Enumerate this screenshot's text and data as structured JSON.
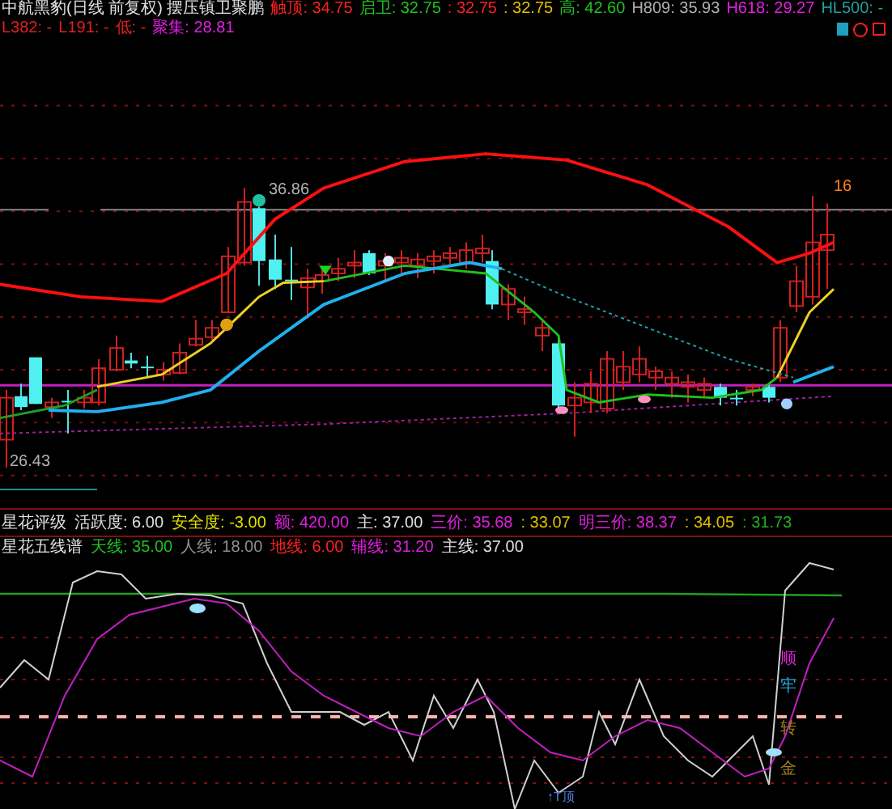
{
  "title": "中航黑豹(日线 前复权) 摆压镇卫聚鹏",
  "indicators": [
    {
      "text": "触顶: 34.75",
      "color": "#ff2020"
    },
    {
      "text": "启卫: 32.75",
      "color": "#20c020"
    },
    {
      "text": ": 32.75",
      "color": "#ff2020"
    },
    {
      "text": ": 32.75",
      "color": "#e0c000"
    },
    {
      "text": "高: 42.60",
      "color": "#20c020"
    },
    {
      "text": "H809: 35.93",
      "color": "#b0b0b0"
    },
    {
      "text": "H618: 29.27",
      "color": "#e020e0"
    },
    {
      "text": "HL500: -",
      "color": "#20a0a0"
    },
    {
      "text": "L382: -",
      "color": "#e02020"
    },
    {
      "text": "L191: -",
      "color": "#e02020"
    },
    {
      "text": "低: -",
      "color": "#e02020"
    },
    {
      "text": "聚集: 28.81",
      "color": "#e020e0"
    }
  ],
  "main_chart": {
    "high_label": "36.86",
    "low_label": "26.43",
    "count_label": "16"
  },
  "panels": [
    {
      "name": "星花评级",
      "values": [
        {
          "text": "活跃度: 6.00",
          "color": "#e0e0e0"
        },
        {
          "text": "安全度: -3.00",
          "color": "#e0e000"
        },
        {
          "text": "额: 420.00",
          "color": "#e020e0"
        },
        {
          "text": "主: 37.00",
          "color": "#e0e0e0"
        },
        {
          "text": "三价: 35.68",
          "color": "#e020e0"
        },
        {
          "text": ": 33.07",
          "color": "#e0c000"
        },
        {
          "text": "明三价: 38.37",
          "color": "#e020e0"
        },
        {
          "text": ": 34.05",
          "color": "#e0c000"
        },
        {
          "text": ": 31.73",
          "color": "#20b020"
        }
      ]
    },
    {
      "name": "星花五线谱",
      "values": [
        {
          "text": "天线: 35.00",
          "color": "#20c020"
        },
        {
          "text": "人线: 18.00",
          "color": "#909090"
        },
        {
          "text": "地线: 6.00",
          "color": "#ff2020"
        },
        {
          "text": "辅线: 31.20",
          "color": "#e020e0"
        },
        {
          "text": "主线: 37.00",
          "color": "#e0e0e0"
        }
      ]
    }
  ],
  "signals": [
    {
      "text": "顺",
      "color": "#e020e0"
    },
    {
      "text": "牢",
      "color": "#20b0e0"
    },
    {
      "text": "转",
      "color": "#a08020"
    },
    {
      "text": "金",
      "color": "#a08020"
    }
  ],
  "bottom_label": "↑T顶"
}
